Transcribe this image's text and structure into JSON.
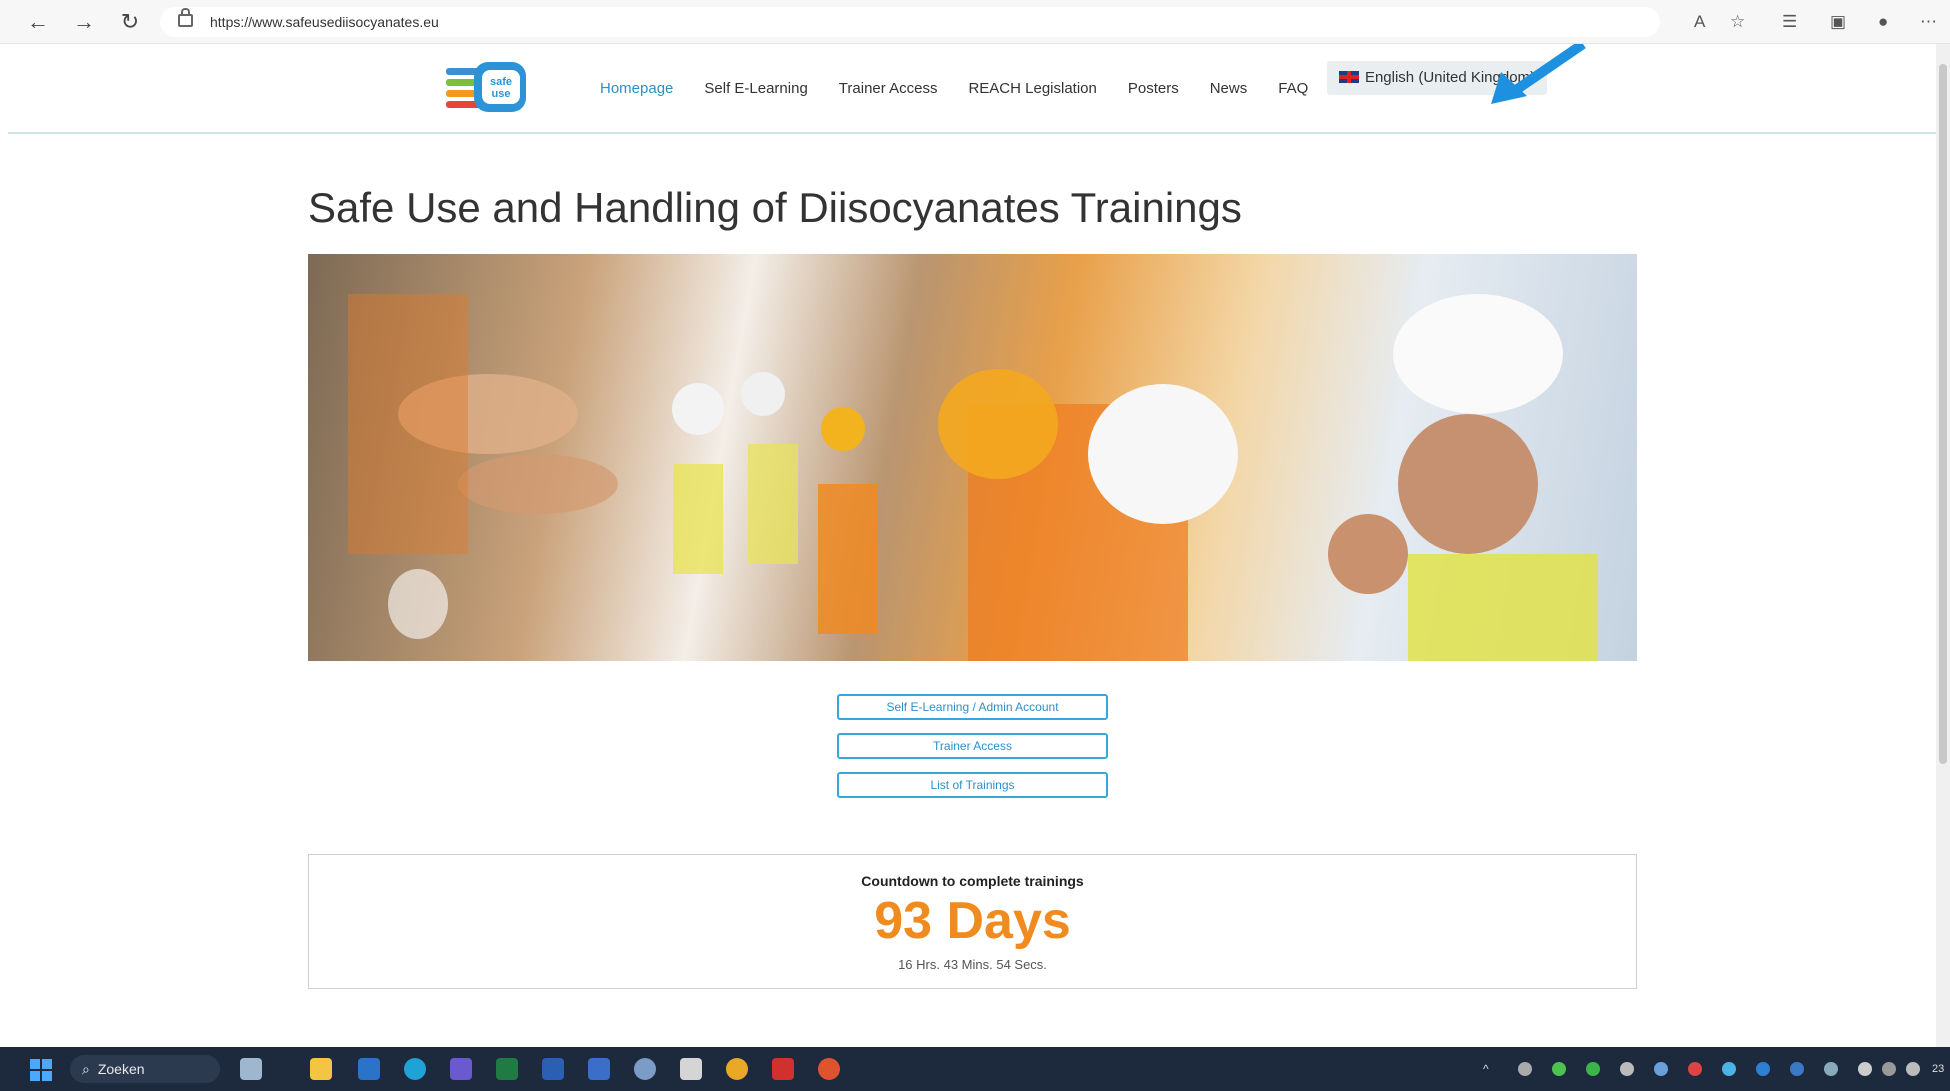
{
  "browser": {
    "url": "https://www.safeusediisocyanates.eu"
  },
  "site": {
    "logo_text": "safe use",
    "nav": [
      {
        "label": "Homepage",
        "active": true
      },
      {
        "label": "Self E-Learning",
        "active": false
      },
      {
        "label": "Trainer Access",
        "active": false
      },
      {
        "label": "REACH Legislation",
        "active": false
      },
      {
        "label": "Posters",
        "active": false
      },
      {
        "label": "News",
        "active": false
      },
      {
        "label": "FAQ",
        "active": false
      }
    ],
    "language": "English (United Kingdom)"
  },
  "main": {
    "title": "Safe Use and Handling of Diisocyanates Trainings",
    "buttons": [
      "Self E-Learning / Admin Account",
      "Trainer Access",
      "List of Trainings"
    ],
    "countdown": {
      "label": "Countdown to complete trainings",
      "days": "93 Days",
      "time": "16 Hrs. 43 Mins. 54 Secs."
    }
  },
  "taskbar": {
    "search_label": "Zoeken",
    "clock": "23"
  },
  "colors": {
    "accent": "#2e8fc8",
    "countdown": "#ef8b1f",
    "annotation_arrow": "#1e90e0"
  }
}
